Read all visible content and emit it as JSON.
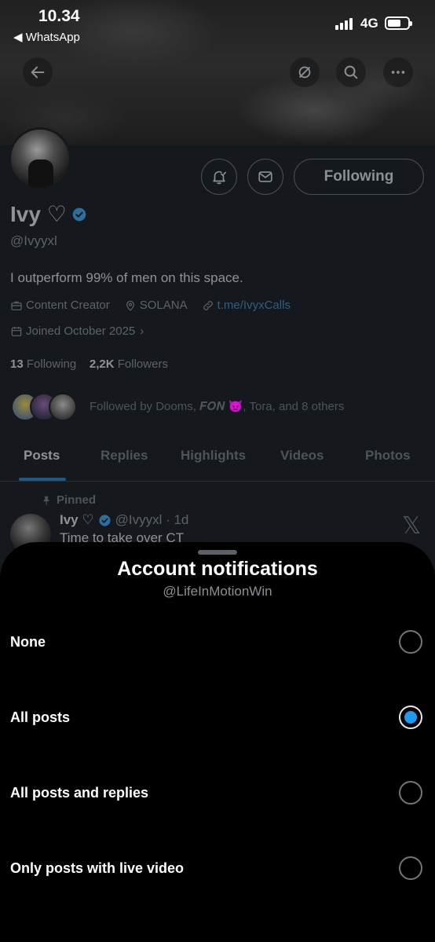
{
  "status_bar": {
    "time": "10.34",
    "back_app": "◀ WhatsApp",
    "network": "4G"
  },
  "profile": {
    "name": "Ivy ♡",
    "handle": "@Ivyyxl",
    "bio": "I outperform 99% of men on this space.",
    "category": "Content Creator",
    "location": "SOLANA",
    "link": "t.me/IvyxCalls",
    "joined": "Joined October 2025",
    "following_count": "13",
    "following_label": "Following",
    "followers_count": "2,2K",
    "followers_label": "Followers",
    "followed_by": "Followed by Dooms, 𝑭𝑶𝑵 👿, Tora, and 8 others",
    "following_button": "Following"
  },
  "tabs": [
    {
      "label": "Posts",
      "active": true
    },
    {
      "label": "Replies",
      "active": false
    },
    {
      "label": "Highlights",
      "active": false
    },
    {
      "label": "Videos",
      "active": false
    },
    {
      "label": "Photos",
      "active": false
    }
  ],
  "pinned_post": {
    "pinned_label": "Pinned",
    "author": "Ivy ♡",
    "handle_time": "@Ivyyxl · 1d",
    "text": "Time to take over CT"
  },
  "sheet": {
    "title": "Account notifications",
    "subtitle": "@LifeInMotionWin",
    "options": [
      {
        "label": "None",
        "selected": false
      },
      {
        "label": "All posts",
        "selected": true
      },
      {
        "label": "All posts and replies",
        "selected": false
      },
      {
        "label": "Only posts with live video",
        "selected": false
      }
    ]
  },
  "colors": {
    "accent": "#1d9bf0",
    "sheet_bg": "#000000",
    "dimmed_page_bg": "#15181c"
  }
}
